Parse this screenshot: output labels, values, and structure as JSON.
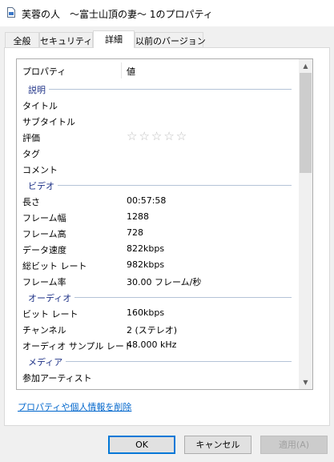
{
  "window": {
    "title": "芙蓉の人　～富士山頂の妻～ 1のプロパティ"
  },
  "tabs": [
    {
      "label": "全般"
    },
    {
      "label": "セキュリティ"
    },
    {
      "label": "詳細"
    },
    {
      "label": "以前のバージョン"
    }
  ],
  "details": {
    "header": {
      "property": "プロパティ",
      "value": "値"
    },
    "groups": {
      "description": "説明",
      "video": "ビデオ",
      "audio": "オーディオ",
      "media": "メディア"
    },
    "rows": {
      "title": {
        "k": "タイトル",
        "v": ""
      },
      "subtitle": {
        "k": "サブタイトル",
        "v": ""
      },
      "rating": {
        "k": "評価",
        "stars": "☆☆☆☆☆"
      },
      "tags": {
        "k": "タグ",
        "v": ""
      },
      "comments": {
        "k": "コメント",
        "v": ""
      },
      "length": {
        "k": "長さ",
        "v": "00:57:58"
      },
      "frame_width": {
        "k": "フレーム幅",
        "v": "1288"
      },
      "frame_height": {
        "k": "フレーム高",
        "v": "728"
      },
      "data_rate": {
        "k": "データ速度",
        "v": "822kbps"
      },
      "total_bitrate": {
        "k": "総ビット レート",
        "v": "982kbps"
      },
      "frame_rate": {
        "k": "フレーム率",
        "v": "30.00 フレーム/秒"
      },
      "bitrate": {
        "k": "ビット レート",
        "v": "160kbps"
      },
      "channels": {
        "k": "チャンネル",
        "v": "2 (ステレオ)"
      },
      "sample_rate": {
        "k": "オーディオ サンプル レート",
        "v": "48.000 kHz"
      },
      "contributing_artists": {
        "k": "参加アーティスト",
        "v": ""
      }
    },
    "rating_stars": 0
  },
  "remove_link": "プロパティや個人情報を削除",
  "buttons": {
    "ok": "OK",
    "cancel": "キャンセル",
    "apply": "適用(A)"
  }
}
